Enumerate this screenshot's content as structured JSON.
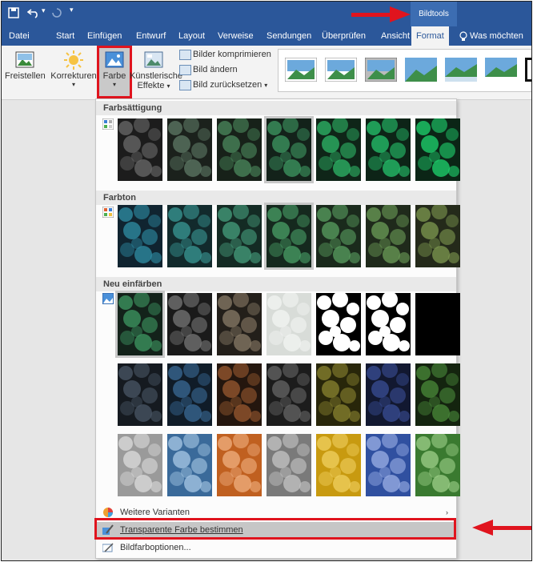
{
  "titlebar": {
    "save_icon": "save-icon",
    "undo_icon": "undo-icon",
    "redo_icon": "redo-icon",
    "context_tab": "Bildtools"
  },
  "tabs": [
    {
      "label": "Datei"
    },
    {
      "label": "Start"
    },
    {
      "label": "Einfügen"
    },
    {
      "label": "Entwurf"
    },
    {
      "label": "Layout"
    },
    {
      "label": "Verweise"
    },
    {
      "label": "Sendungen"
    },
    {
      "label": "Überprüfen"
    },
    {
      "label": "Ansicht"
    },
    {
      "label": "Format"
    },
    {
      "label": "Was möchten"
    }
  ],
  "ribbon": {
    "freistellen": "Freistellen",
    "korrekturen": "Korrekturen",
    "farbe": "Farbe",
    "kuenstlerische_line1": "Künstlerische",
    "kuenstlerische_line2": "Effekte",
    "bilder_komprimieren": "Bilder komprimieren",
    "bild_aendern": "Bild ändern",
    "bild_zuruecksetzen": "Bild zurücksetzen"
  },
  "dropdown": {
    "sections": [
      {
        "title": "Farbsättigung"
      },
      {
        "title": "Farbton"
      },
      {
        "title": "Neu einfärben"
      }
    ],
    "menu": {
      "weitere_varianten": "Weitere Varianten",
      "transparente_farbe": "Transparente Farbe bestimmen",
      "bildfarboptionen": "Bildfarboptionen..."
    }
  },
  "colors": {
    "ribbon_blue": "#2b579a",
    "highlight_red": "#e0141e"
  }
}
